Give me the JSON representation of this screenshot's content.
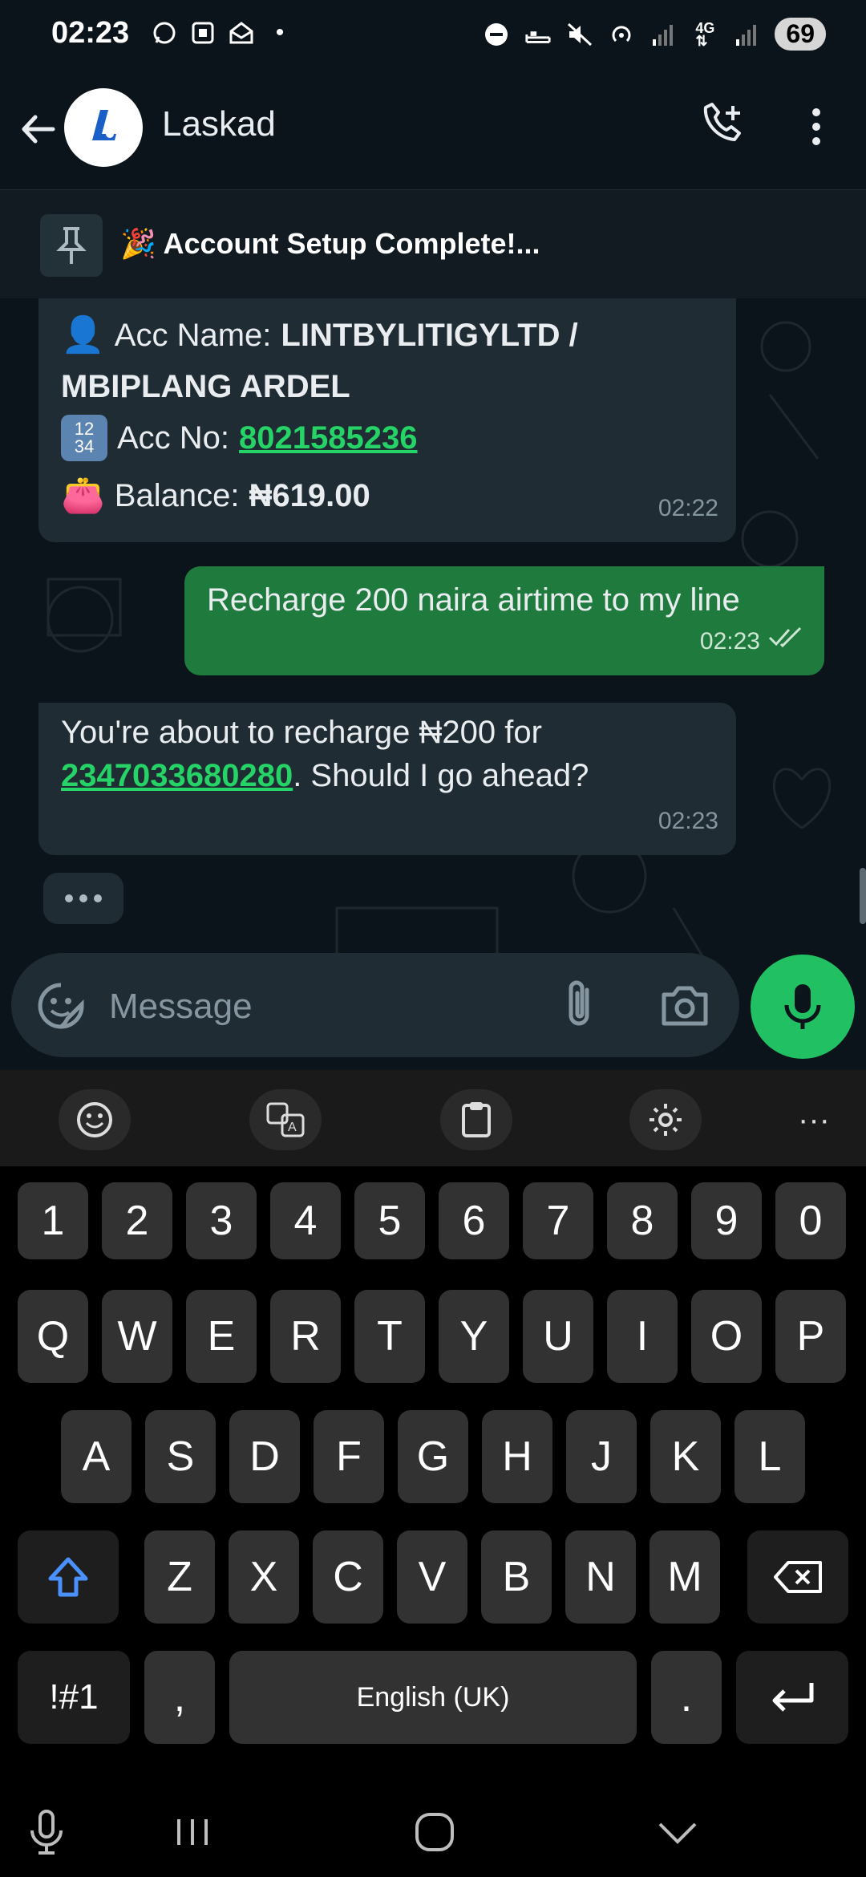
{
  "status_bar": {
    "time": "02:23",
    "battery": "69"
  },
  "app_bar": {
    "title": "Laskad",
    "avatar_letter": "L"
  },
  "pinned": {
    "emoji": "🎉",
    "text": "Account Setup Complete!..."
  },
  "messages": {
    "m1": {
      "line1_label": "Acc Name: ",
      "line1_value": "LINTBYLITIGYLTD /",
      "line1_value2": "MBIPLANG ARDEL",
      "line2_label": "Acc No: ",
      "line2_value": "8021585236",
      "line3_label": "Balance: ",
      "line3_value": "₦619.00",
      "time": "02:22"
    },
    "m2": {
      "text": "Recharge 200 naira airtime to my line",
      "time": "02:23"
    },
    "m3": {
      "text_a": "You're about to recharge ₦200 for",
      "number": "2347033680280",
      "text_b": ". Should I go ahead?",
      "time": "02:23"
    }
  },
  "composer": {
    "placeholder": "Message"
  },
  "keyboard": {
    "row_numbers": [
      "1",
      "2",
      "3",
      "4",
      "5",
      "6",
      "7",
      "8",
      "9",
      "0"
    ],
    "row_q": [
      "Q",
      "W",
      "E",
      "R",
      "T",
      "Y",
      "U",
      "I",
      "O",
      "P"
    ],
    "row_a": [
      "A",
      "S",
      "D",
      "F",
      "G",
      "H",
      "J",
      "K",
      "L"
    ],
    "row_z": [
      "Z",
      "X",
      "C",
      "V",
      "B",
      "N",
      "M"
    ],
    "symbols_label": "!#1",
    "comma": ",",
    "space_label": "English (UK)",
    "period": ".",
    "toolbar_more": "···"
  },
  "colors": {
    "background": "#0b141a",
    "incoming_bubble": "#202c33",
    "outgoing_bubble": "#1f7a3e",
    "accent_green": "#25d366",
    "mic_button": "#21c063"
  }
}
